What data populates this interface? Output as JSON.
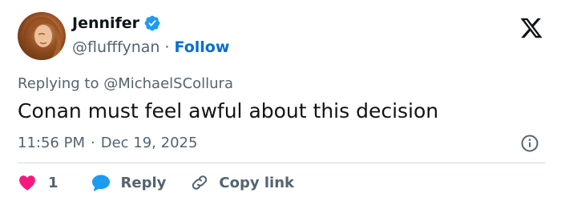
{
  "user": {
    "name": "Jennifer",
    "handle": "@flufffynan",
    "separator": "·",
    "follow_label": "Follow"
  },
  "reply": {
    "prefix": "Replying to ",
    "mention": "@MichaelSCollura"
  },
  "tweet": {
    "text": "Conan must feel awful about this decision"
  },
  "meta": {
    "time": "11:56 PM",
    "separator": "·",
    "date": "Dec 19, 2025"
  },
  "actions": {
    "like_count": "1",
    "reply_label": "Reply",
    "copy_label": "Copy link"
  },
  "icons": {
    "verified": "verified-badge-icon",
    "x_logo": "x-logo-icon",
    "info": "info-icon",
    "heart": "heart-icon",
    "reply": "reply-bubble-icon",
    "link": "link-icon"
  },
  "colors": {
    "heart": "#f91880",
    "reply_bubble": "#1d9bf0",
    "follow": "#006fd6",
    "verified": "#1d9bf0",
    "muted": "#536471",
    "text": "#0f1419",
    "divider": "#cfd9de"
  }
}
